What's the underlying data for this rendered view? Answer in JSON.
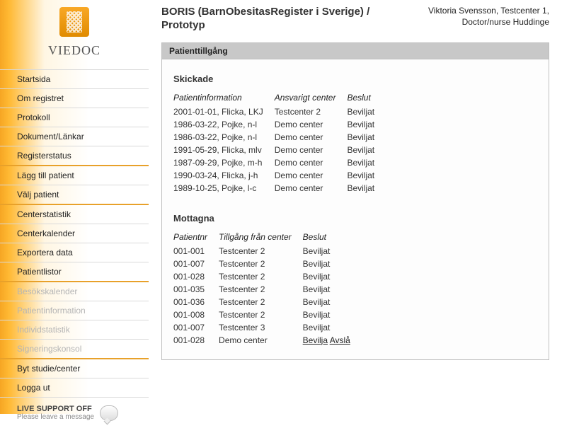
{
  "brand": "VIEDOC",
  "header": {
    "title": "BORIS (BarnObesitasRegister i Sverige) / Prototyp",
    "user_line1": "Viktoria Svensson, Testcenter 1,",
    "user_line2": "Doctor/nurse Huddinge"
  },
  "sidebar": {
    "items": [
      {
        "label": "Startsida",
        "disabled": false,
        "sep": false
      },
      {
        "label": "Om registret",
        "disabled": false,
        "sep": false
      },
      {
        "label": "Protokoll",
        "disabled": false,
        "sep": false
      },
      {
        "label": "Dokument/Länkar",
        "disabled": false,
        "sep": false
      },
      {
        "label": "Registerstatus",
        "disabled": false,
        "sep": false
      },
      {
        "label": "Lägg till patient",
        "disabled": false,
        "sep": true
      },
      {
        "label": "Välj patient",
        "disabled": false,
        "sep": false
      },
      {
        "label": "Centerstatistik",
        "disabled": false,
        "sep": true
      },
      {
        "label": "Centerkalender",
        "disabled": false,
        "sep": false
      },
      {
        "label": "Exportera data",
        "disabled": false,
        "sep": false
      },
      {
        "label": "Patientlistor",
        "disabled": false,
        "sep": false
      },
      {
        "label": "Besökskalender",
        "disabled": true,
        "sep": true
      },
      {
        "label": "Patientinformation",
        "disabled": true,
        "sep": false
      },
      {
        "label": "Individstatistik",
        "disabled": true,
        "sep": false
      },
      {
        "label": "Signeringskonsol",
        "disabled": true,
        "sep": false
      },
      {
        "label": "Byt studie/center",
        "disabled": false,
        "sep": true
      },
      {
        "label": "Logga ut",
        "disabled": false,
        "sep": false
      }
    ]
  },
  "support": {
    "title": "LIVE SUPPORT OFF",
    "subtitle": "Please leave a message"
  },
  "panel": {
    "title": "Patienttillgång",
    "sent": {
      "heading": "Skickade",
      "cols": [
        "Patientinformation",
        "Ansvarigt center",
        "Beslut"
      ],
      "rows": [
        {
          "info": "2001-01-01, Flicka, LKJ",
          "center": "Testcenter 2",
          "decision": "Beviljat"
        },
        {
          "info": "1986-03-22, Pojke, n-l",
          "center": "Demo center",
          "decision": "Beviljat"
        },
        {
          "info": "1986-03-22, Pojke, n-l",
          "center": "Demo center",
          "decision": "Beviljat"
        },
        {
          "info": "1991-05-29, Flicka, mlv",
          "center": "Demo center",
          "decision": "Beviljat"
        },
        {
          "info": "1987-09-29, Pojke, m-h",
          "center": "Demo center",
          "decision": "Beviljat"
        },
        {
          "info": "1990-03-24, Flicka, j-h",
          "center": "Demo center",
          "decision": "Beviljat"
        },
        {
          "info": "1989-10-25, Pojke, l-c",
          "center": "Demo center",
          "decision": "Beviljat"
        }
      ]
    },
    "received": {
      "heading": "Mottagna",
      "cols": [
        "Patientnr",
        "Tillgång från center",
        "Beslut"
      ],
      "rows": [
        {
          "nr": "001-001",
          "center": "Testcenter 2",
          "decision": "Beviljat"
        },
        {
          "nr": "001-007",
          "center": "Testcenter 2",
          "decision": "Beviljat"
        },
        {
          "nr": "001-028",
          "center": "Testcenter 2",
          "decision": "Beviljat"
        },
        {
          "nr": "001-035",
          "center": "Testcenter 2",
          "decision": "Beviljat"
        },
        {
          "nr": "001-036",
          "center": "Testcenter 2",
          "decision": "Beviljat"
        },
        {
          "nr": "001-008",
          "center": "Testcenter 2",
          "decision": "Beviljat"
        },
        {
          "nr": "001-007",
          "center": "Testcenter 3",
          "decision": "Beviljat"
        },
        {
          "nr": "001-028",
          "center": "Demo center",
          "decision": null,
          "actions": [
            "Bevilja",
            "Avslå"
          ]
        }
      ]
    }
  }
}
